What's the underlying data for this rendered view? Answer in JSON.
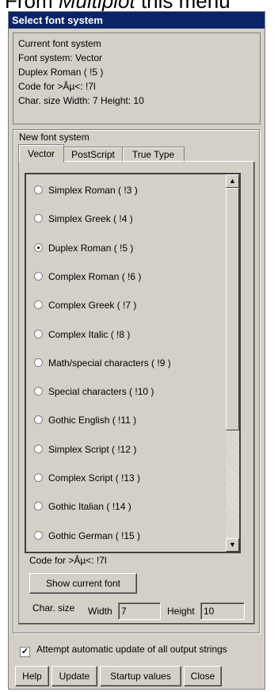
{
  "header_text": {
    "prefix": "From ",
    "italic": "Multiplot",
    "suffix": " this menu"
  },
  "dialog": {
    "title": "Select font system"
  },
  "current": {
    "heading": "Current font system",
    "font_system": "Font system: Vector",
    "font": "Duplex Roman ( !5 )",
    "code": "Code for >Âµ<: !7l",
    "char_size": "Char. size   Width: 7  Height: 10"
  },
  "new_system": {
    "label": "New font system",
    "tabs": [
      {
        "label": "Vector",
        "active": true
      },
      {
        "label": "PostScript",
        "active": false
      },
      {
        "label": "True Type",
        "active": false
      }
    ],
    "fonts": [
      {
        "label": "Simplex Roman ( !3 )",
        "checked": false
      },
      {
        "label": "Simplex Greek ( !4 )",
        "checked": false
      },
      {
        "label": "Duplex Roman ( !5 )",
        "checked": true
      },
      {
        "label": "Complex Roman ( !6 )",
        "checked": false
      },
      {
        "label": "Complex Greek ( !7 )",
        "checked": false
      },
      {
        "label": "Complex Italic ( !8 )",
        "checked": false
      },
      {
        "label": "Math/special characters ( !9 )",
        "checked": false
      },
      {
        "label": "Special characters ( !10 )",
        "checked": false
      },
      {
        "label": "Gothic English ( !11 )",
        "checked": false
      },
      {
        "label": "Simplex Script ( !12 )",
        "checked": false
      },
      {
        "label": "Complex Script ( !13 )",
        "checked": false
      },
      {
        "label": "Gothic Italian ( !14 )",
        "checked": false
      },
      {
        "label": "Gothic German ( !15 )",
        "checked": false
      }
    ],
    "code_line": "Code for >Âµ<: !7l",
    "show_button": "Show current font",
    "char_size_label": "Char. size",
    "width_label": "Width",
    "width_value": "7",
    "height_label": "Height",
    "height_value": "10"
  },
  "auto_update": {
    "label": "Attempt automatic update of all output strings",
    "checked": true
  },
  "buttons": {
    "help": "Help",
    "update": "Update",
    "startup": "Startup values",
    "close": "Close"
  },
  "icons": {
    "scroll_up": "up-arrow",
    "scroll_down": "down-arrow",
    "checkmark": "check"
  }
}
